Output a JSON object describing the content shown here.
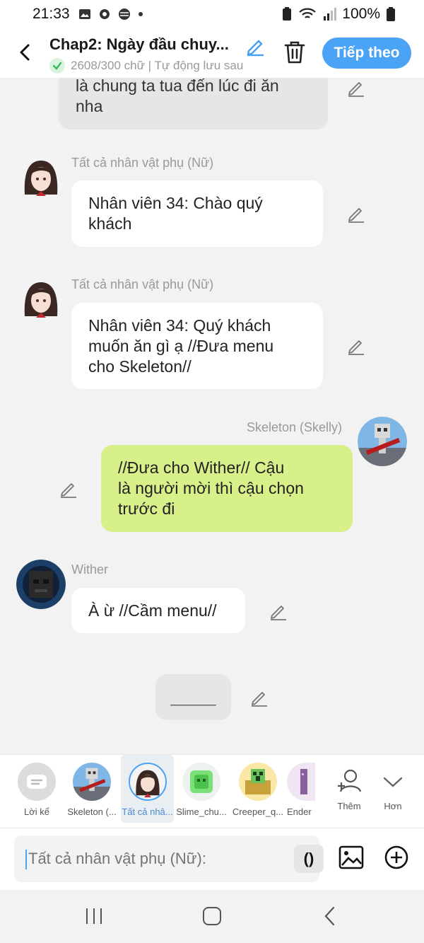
{
  "status_bar": {
    "time": "21:33",
    "battery": "100%"
  },
  "header": {
    "title": "Chap2: Ngày đầu chuy...",
    "save_status": "2608/300 chữ | Tự động lưu sau",
    "next_label": "Tiếp theo"
  },
  "messages": [
    {
      "sender": "",
      "text": "là chung ta tua đến lúc đi ăn nha",
      "lines": [
        "là chung ta tua đến lúc đi ăn",
        "nha"
      ]
    },
    {
      "sender": "Tất cả nhân vật phụ (Nữ)",
      "lines": [
        "Nhân viên 34: Chào quý",
        "khách"
      ]
    },
    {
      "sender": "Tất cả nhân vật phụ (Nữ)",
      "lines": [
        "Nhân viên 34: Quý khách",
        "muốn ăn gì ạ //Đưa menu",
        "cho Skeleton//"
      ]
    },
    {
      "sender": "Skeleton (Skelly)",
      "lines": [
        "//Đưa cho Wither// Cậu",
        "là người mời thì cậu chọn",
        "trước đi"
      ]
    },
    {
      "sender": "Wither",
      "lines": [
        "À ừ //Cầm menu//"
      ]
    },
    {
      "sender": "",
      "lines": [
        "_____"
      ]
    }
  ],
  "characters": [
    {
      "label": "Lời kể",
      "icon": "narration-icon"
    },
    {
      "label": "Skeleton (...",
      "icon": "skeleton-avatar"
    },
    {
      "label": "Tất cả nhâ...",
      "icon": "girl-avatar",
      "selected": true
    },
    {
      "label": "Slime_chu...",
      "icon": "slime-avatar"
    },
    {
      "label": "Creeper_q...",
      "icon": "creeper-avatar"
    },
    {
      "label": "Ender",
      "icon": "enderman-avatar"
    },
    {
      "label": "Thêm",
      "icon": "add-person-icon"
    },
    {
      "label": "Hơn",
      "icon": "chevron-down-icon"
    }
  ],
  "input": {
    "placeholder": "Tất cả nhân vật phụ (Nữ):",
    "paren_label": "()"
  },
  "colors": {
    "accent": "#4aa3f5",
    "my_bubble": "#d7f08a",
    "background": "#f2f2f2"
  }
}
